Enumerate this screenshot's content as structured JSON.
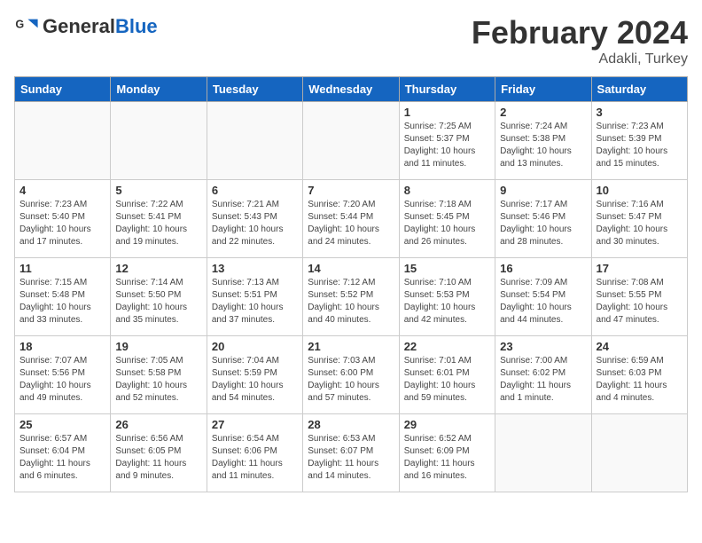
{
  "header": {
    "logo_general": "General",
    "logo_blue": "Blue",
    "month_title": "February 2024",
    "location": "Adakli, Turkey"
  },
  "weekdays": [
    "Sunday",
    "Monday",
    "Tuesday",
    "Wednesday",
    "Thursday",
    "Friday",
    "Saturday"
  ],
  "weeks": [
    [
      {
        "day": "",
        "info": ""
      },
      {
        "day": "",
        "info": ""
      },
      {
        "day": "",
        "info": ""
      },
      {
        "day": "",
        "info": ""
      },
      {
        "day": "1",
        "info": "Sunrise: 7:25 AM\nSunset: 5:37 PM\nDaylight: 10 hours\nand 11 minutes."
      },
      {
        "day": "2",
        "info": "Sunrise: 7:24 AM\nSunset: 5:38 PM\nDaylight: 10 hours\nand 13 minutes."
      },
      {
        "day": "3",
        "info": "Sunrise: 7:23 AM\nSunset: 5:39 PM\nDaylight: 10 hours\nand 15 minutes."
      }
    ],
    [
      {
        "day": "4",
        "info": "Sunrise: 7:23 AM\nSunset: 5:40 PM\nDaylight: 10 hours\nand 17 minutes."
      },
      {
        "day": "5",
        "info": "Sunrise: 7:22 AM\nSunset: 5:41 PM\nDaylight: 10 hours\nand 19 minutes."
      },
      {
        "day": "6",
        "info": "Sunrise: 7:21 AM\nSunset: 5:43 PM\nDaylight: 10 hours\nand 22 minutes."
      },
      {
        "day": "7",
        "info": "Sunrise: 7:20 AM\nSunset: 5:44 PM\nDaylight: 10 hours\nand 24 minutes."
      },
      {
        "day": "8",
        "info": "Sunrise: 7:18 AM\nSunset: 5:45 PM\nDaylight: 10 hours\nand 26 minutes."
      },
      {
        "day": "9",
        "info": "Sunrise: 7:17 AM\nSunset: 5:46 PM\nDaylight: 10 hours\nand 28 minutes."
      },
      {
        "day": "10",
        "info": "Sunrise: 7:16 AM\nSunset: 5:47 PM\nDaylight: 10 hours\nand 30 minutes."
      }
    ],
    [
      {
        "day": "11",
        "info": "Sunrise: 7:15 AM\nSunset: 5:48 PM\nDaylight: 10 hours\nand 33 minutes."
      },
      {
        "day": "12",
        "info": "Sunrise: 7:14 AM\nSunset: 5:50 PM\nDaylight: 10 hours\nand 35 minutes."
      },
      {
        "day": "13",
        "info": "Sunrise: 7:13 AM\nSunset: 5:51 PM\nDaylight: 10 hours\nand 37 minutes."
      },
      {
        "day": "14",
        "info": "Sunrise: 7:12 AM\nSunset: 5:52 PM\nDaylight: 10 hours\nand 40 minutes."
      },
      {
        "day": "15",
        "info": "Sunrise: 7:10 AM\nSunset: 5:53 PM\nDaylight: 10 hours\nand 42 minutes."
      },
      {
        "day": "16",
        "info": "Sunrise: 7:09 AM\nSunset: 5:54 PM\nDaylight: 10 hours\nand 44 minutes."
      },
      {
        "day": "17",
        "info": "Sunrise: 7:08 AM\nSunset: 5:55 PM\nDaylight: 10 hours\nand 47 minutes."
      }
    ],
    [
      {
        "day": "18",
        "info": "Sunrise: 7:07 AM\nSunset: 5:56 PM\nDaylight: 10 hours\nand 49 minutes."
      },
      {
        "day": "19",
        "info": "Sunrise: 7:05 AM\nSunset: 5:58 PM\nDaylight: 10 hours\nand 52 minutes."
      },
      {
        "day": "20",
        "info": "Sunrise: 7:04 AM\nSunset: 5:59 PM\nDaylight: 10 hours\nand 54 minutes."
      },
      {
        "day": "21",
        "info": "Sunrise: 7:03 AM\nSunset: 6:00 PM\nDaylight: 10 hours\nand 57 minutes."
      },
      {
        "day": "22",
        "info": "Sunrise: 7:01 AM\nSunset: 6:01 PM\nDaylight: 10 hours\nand 59 minutes."
      },
      {
        "day": "23",
        "info": "Sunrise: 7:00 AM\nSunset: 6:02 PM\nDaylight: 11 hours\nand 1 minute."
      },
      {
        "day": "24",
        "info": "Sunrise: 6:59 AM\nSunset: 6:03 PM\nDaylight: 11 hours\nand 4 minutes."
      }
    ],
    [
      {
        "day": "25",
        "info": "Sunrise: 6:57 AM\nSunset: 6:04 PM\nDaylight: 11 hours\nand 6 minutes."
      },
      {
        "day": "26",
        "info": "Sunrise: 6:56 AM\nSunset: 6:05 PM\nDaylight: 11 hours\nand 9 minutes."
      },
      {
        "day": "27",
        "info": "Sunrise: 6:54 AM\nSunset: 6:06 PM\nDaylight: 11 hours\nand 11 minutes."
      },
      {
        "day": "28",
        "info": "Sunrise: 6:53 AM\nSunset: 6:07 PM\nDaylight: 11 hours\nand 14 minutes."
      },
      {
        "day": "29",
        "info": "Sunrise: 6:52 AM\nSunset: 6:09 PM\nDaylight: 11 hours\nand 16 minutes."
      },
      {
        "day": "",
        "info": ""
      },
      {
        "day": "",
        "info": ""
      }
    ]
  ]
}
